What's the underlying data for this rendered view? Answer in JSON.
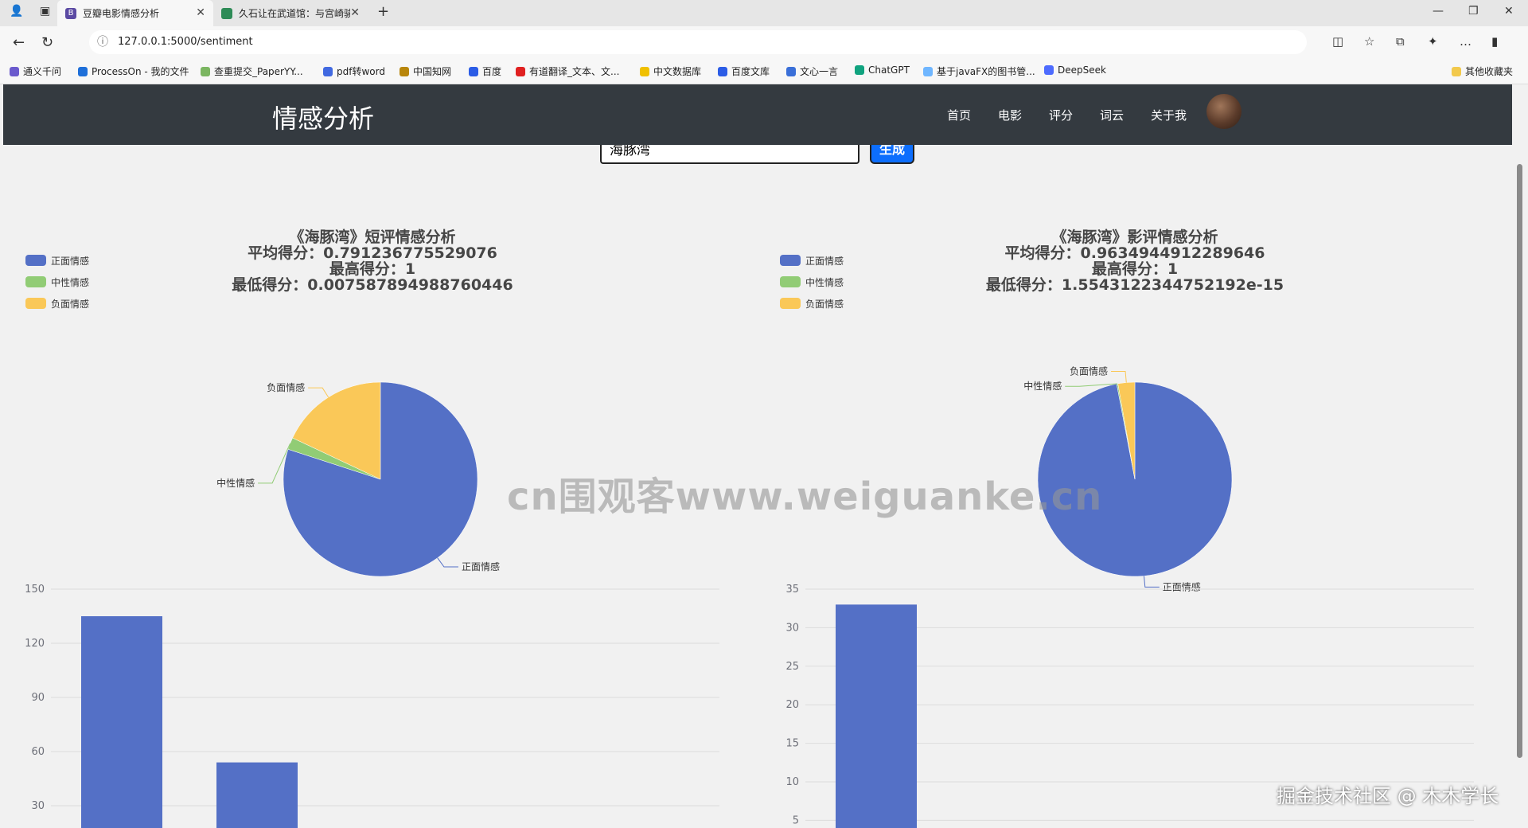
{
  "browser": {
    "tabs": [
      {
        "title": "豆瓣电影情感分析",
        "favicon": "B"
      },
      {
        "title": "久石让在武道馆：与宫崎骏动画·"
      }
    ],
    "url": "127.0.0.1:5000/sentiment",
    "bookmarks": [
      "通义千问",
      "ProcessOn - 我的文件",
      "查重提交_PaperYY...",
      "pdf转word",
      "中国知网",
      "百度",
      "有道翻译_文本、文...",
      "中文数据库",
      "百度文库",
      "文心一言",
      "ChatGPT",
      "基于javaFX的图书管...",
      "DeepSeek",
      "其他收藏夹"
    ]
  },
  "navbar": {
    "brand": "情感分析",
    "links": [
      "首页",
      "电影",
      "评分",
      "词云",
      "关于我"
    ]
  },
  "search": {
    "value": "海豚湾",
    "button": "生成"
  },
  "chart_data": [
    {
      "type": "pie",
      "title_lines": [
        "《海豚湾》短评情感分析",
        "平均得分：0.791236775529076",
        "最高得分：1",
        "最低得分：0.007587894988760446"
      ],
      "legend": [
        "正面情感",
        "中性情感",
        "负面情感"
      ],
      "legend_position": "top-left",
      "labels": [
        "正面情感",
        "中性情感",
        "负面情感"
      ],
      "values": [
        80,
        2,
        18
      ],
      "colors": [
        "#5470c6",
        "#91cc75",
        "#fac858"
      ]
    },
    {
      "type": "pie",
      "title_lines": [
        "《海豚湾》影评情感分析",
        "平均得分：0.9634944912289646",
        "最高得分：1",
        "最低得分：1.5543122344752192e-15"
      ],
      "legend": [
        "正面情感",
        "中性情感",
        "负面情感"
      ],
      "legend_position": "top-left",
      "labels": [
        "正面情感",
        "中性情感",
        "负面情感"
      ],
      "values": [
        97,
        0.2,
        2.8
      ],
      "colors": [
        "#5470c6",
        "#91cc75",
        "#fac858"
      ]
    },
    {
      "type": "bar",
      "yticks": [
        30,
        60,
        90,
        120,
        150
      ],
      "ylim": [
        0,
        150
      ],
      "values": [
        135,
        54
      ],
      "color": "#5470c6",
      "grid": true
    },
    {
      "type": "bar",
      "yticks": [
        5,
        10,
        15,
        20,
        25,
        30,
        35
      ],
      "ylim": [
        0,
        35
      ],
      "values": [
        33
      ],
      "color": "#5470c6",
      "grid": true
    }
  ],
  "watermark": "cn围观客www.weiguanke.cn",
  "corner_watermark": "掘金技术社区 @ 木木学长"
}
